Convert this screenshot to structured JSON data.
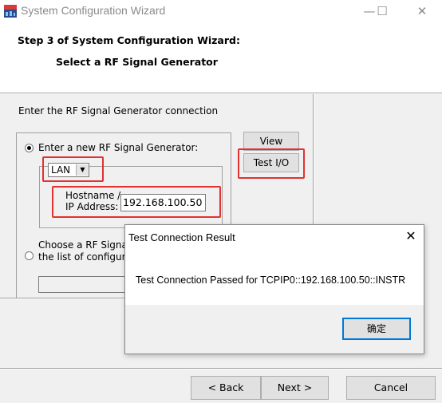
{
  "window": {
    "title": "System Configuration Wizard",
    "minimize_glyph": "—",
    "maximize_glyph": "☐",
    "close_glyph": "✕",
    "icon": "app-icon"
  },
  "header": {
    "step_title": "Step 3 of System Configuration Wizard:",
    "step_subtitle": "Select a RF Signal Generator"
  },
  "body": {
    "instruction": "Enter the RF Signal Generator connection",
    "option_new": {
      "label": "Enter a new RF Signal Generator:",
      "selected": true
    },
    "connection_type": {
      "value": "LAN",
      "arrow": "▼"
    },
    "host": {
      "label_line1": "Hostname /",
      "label_line2": "IP Address:",
      "value": "192.168.100.50"
    },
    "option_existing": {
      "label_line1": "Choose a RF Signa",
      "label_line2": "the list of configur",
      "selected": false
    }
  },
  "side_buttons": {
    "view": "View",
    "test_io": "Test I/O"
  },
  "footer": {
    "back": "< Back",
    "next": "Next >",
    "cancel": "Cancel"
  },
  "dialog": {
    "title": "Test Connection Result",
    "close_glyph": "✕",
    "message": "Test Connection Passed for TCPIP0::192.168.100.50::INSTR",
    "ok": "确定"
  },
  "colors": {
    "highlight_red": "#e0322f",
    "window_bg": "#f0f0f0",
    "focus_blue": "#0078d7"
  }
}
